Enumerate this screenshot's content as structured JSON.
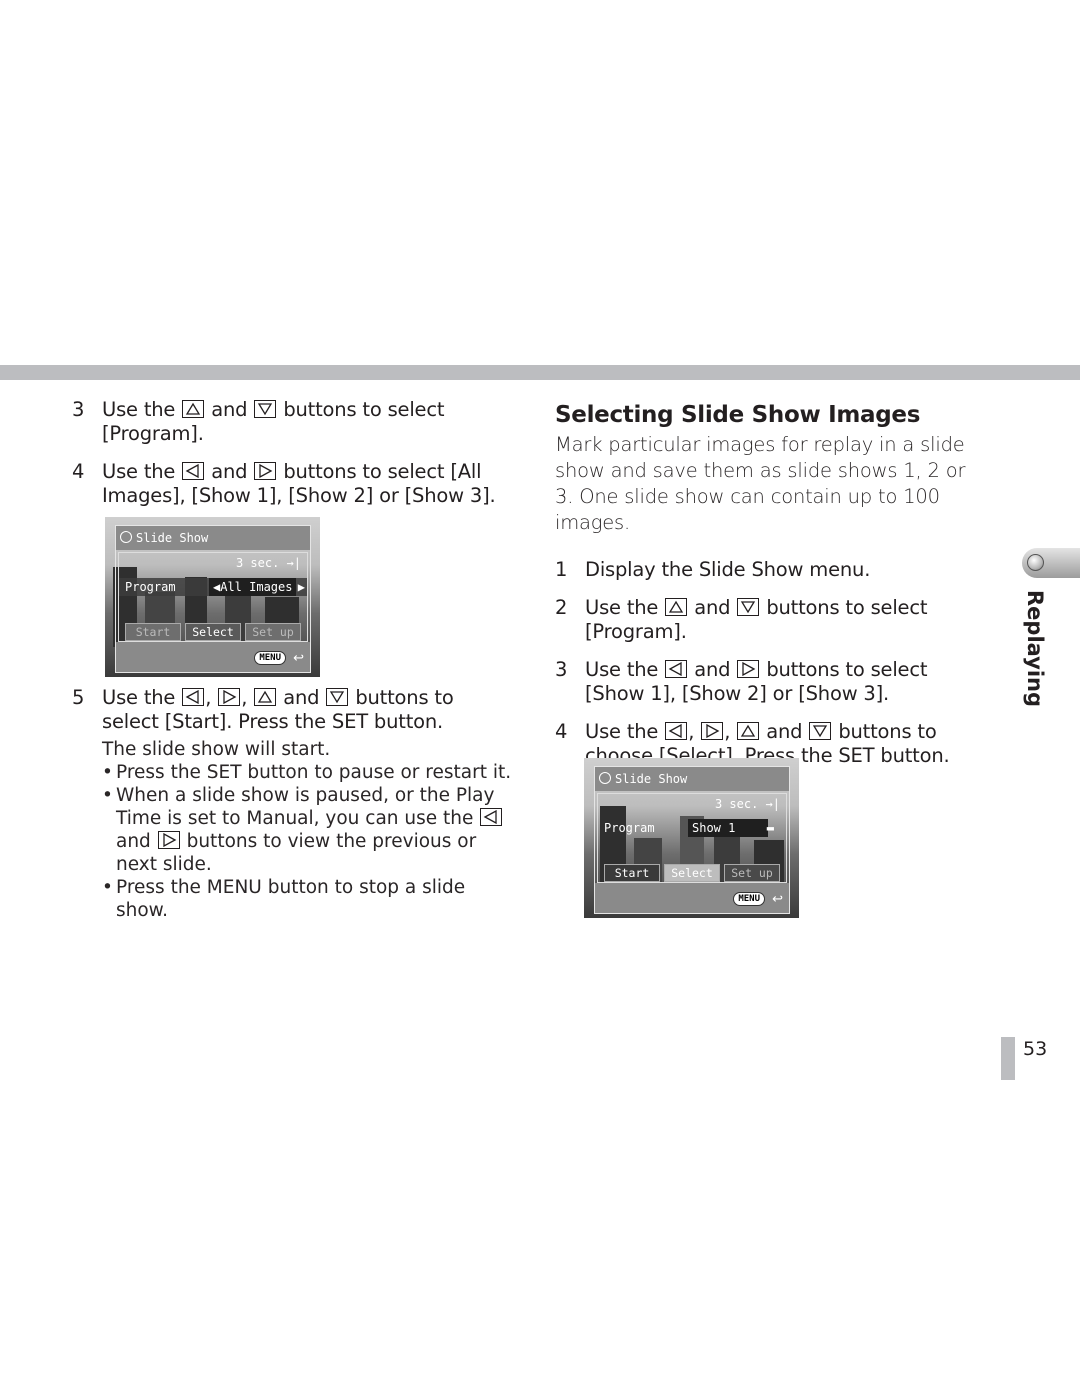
{
  "page_number": "53",
  "section_tab": "Replaying",
  "left": {
    "steps": [
      {
        "num": "3",
        "parts": [
          "Use the",
          "and",
          "buttons to select [Program]."
        ],
        "icons": [
          "up",
          "down"
        ]
      },
      {
        "num": "4",
        "parts": [
          "Use the",
          "and",
          "buttons to select [All Images], [Show 1], [Show 2] or [Show 3]."
        ],
        "icons": [
          "left",
          "right"
        ]
      },
      {
        "num": "5",
        "parts": [
          "Use the",
          ",",
          ",",
          "and",
          "buttons to select [Start]. Press the SET button."
        ],
        "icons": [
          "left",
          "right",
          "up",
          "down"
        ]
      }
    ],
    "step5_result": "The slide show will start.",
    "bullets": [
      "Press the SET button to pause or restart it.",
      {
        "a": "When a slide show is paused, or the Play Time is set to Manual, you can use the",
        "b": "and",
        "c": "buttons to view the previous or next slide."
      },
      "Press the MENU button to stop a slide show."
    ],
    "screen": {
      "title": "Slide Show",
      "time": "3 sec.",
      "program_label": "Program",
      "program_value": "All Images",
      "buttons": [
        "Start",
        "Select",
        "Set up"
      ],
      "selected": "Select",
      "menu_label": "MENU"
    }
  },
  "right": {
    "heading": "Selecting Slide Show Images",
    "intro": "Mark particular images for replay in a slide show and save them as slide shows 1, 2 or 3. One slide show can contain up to 100 images.",
    "steps": [
      {
        "num": "1",
        "text": "Display the Slide Show menu."
      },
      {
        "num": "2",
        "parts": [
          "Use the",
          "and",
          "buttons to select [Program]."
        ],
        "icons": [
          "up",
          "down"
        ]
      },
      {
        "num": "3",
        "parts": [
          "Use the",
          "and",
          "buttons to select [Show 1], [Show 2] or [Show 3]."
        ],
        "icons": [
          "left",
          "right"
        ]
      },
      {
        "num": "4",
        "parts": [
          "Use the",
          ",",
          ",",
          "and",
          "buttons to choose [Select]. Press the SET button."
        ],
        "icons": [
          "left",
          "right",
          "up",
          "down"
        ]
      }
    ],
    "screen": {
      "title": "Slide Show",
      "time": "3 sec.",
      "program_label": "Program",
      "program_value": "Show 1",
      "buttons": [
        "Start",
        "Select",
        "Set up"
      ],
      "selected": "Select",
      "menu_label": "MENU"
    }
  }
}
